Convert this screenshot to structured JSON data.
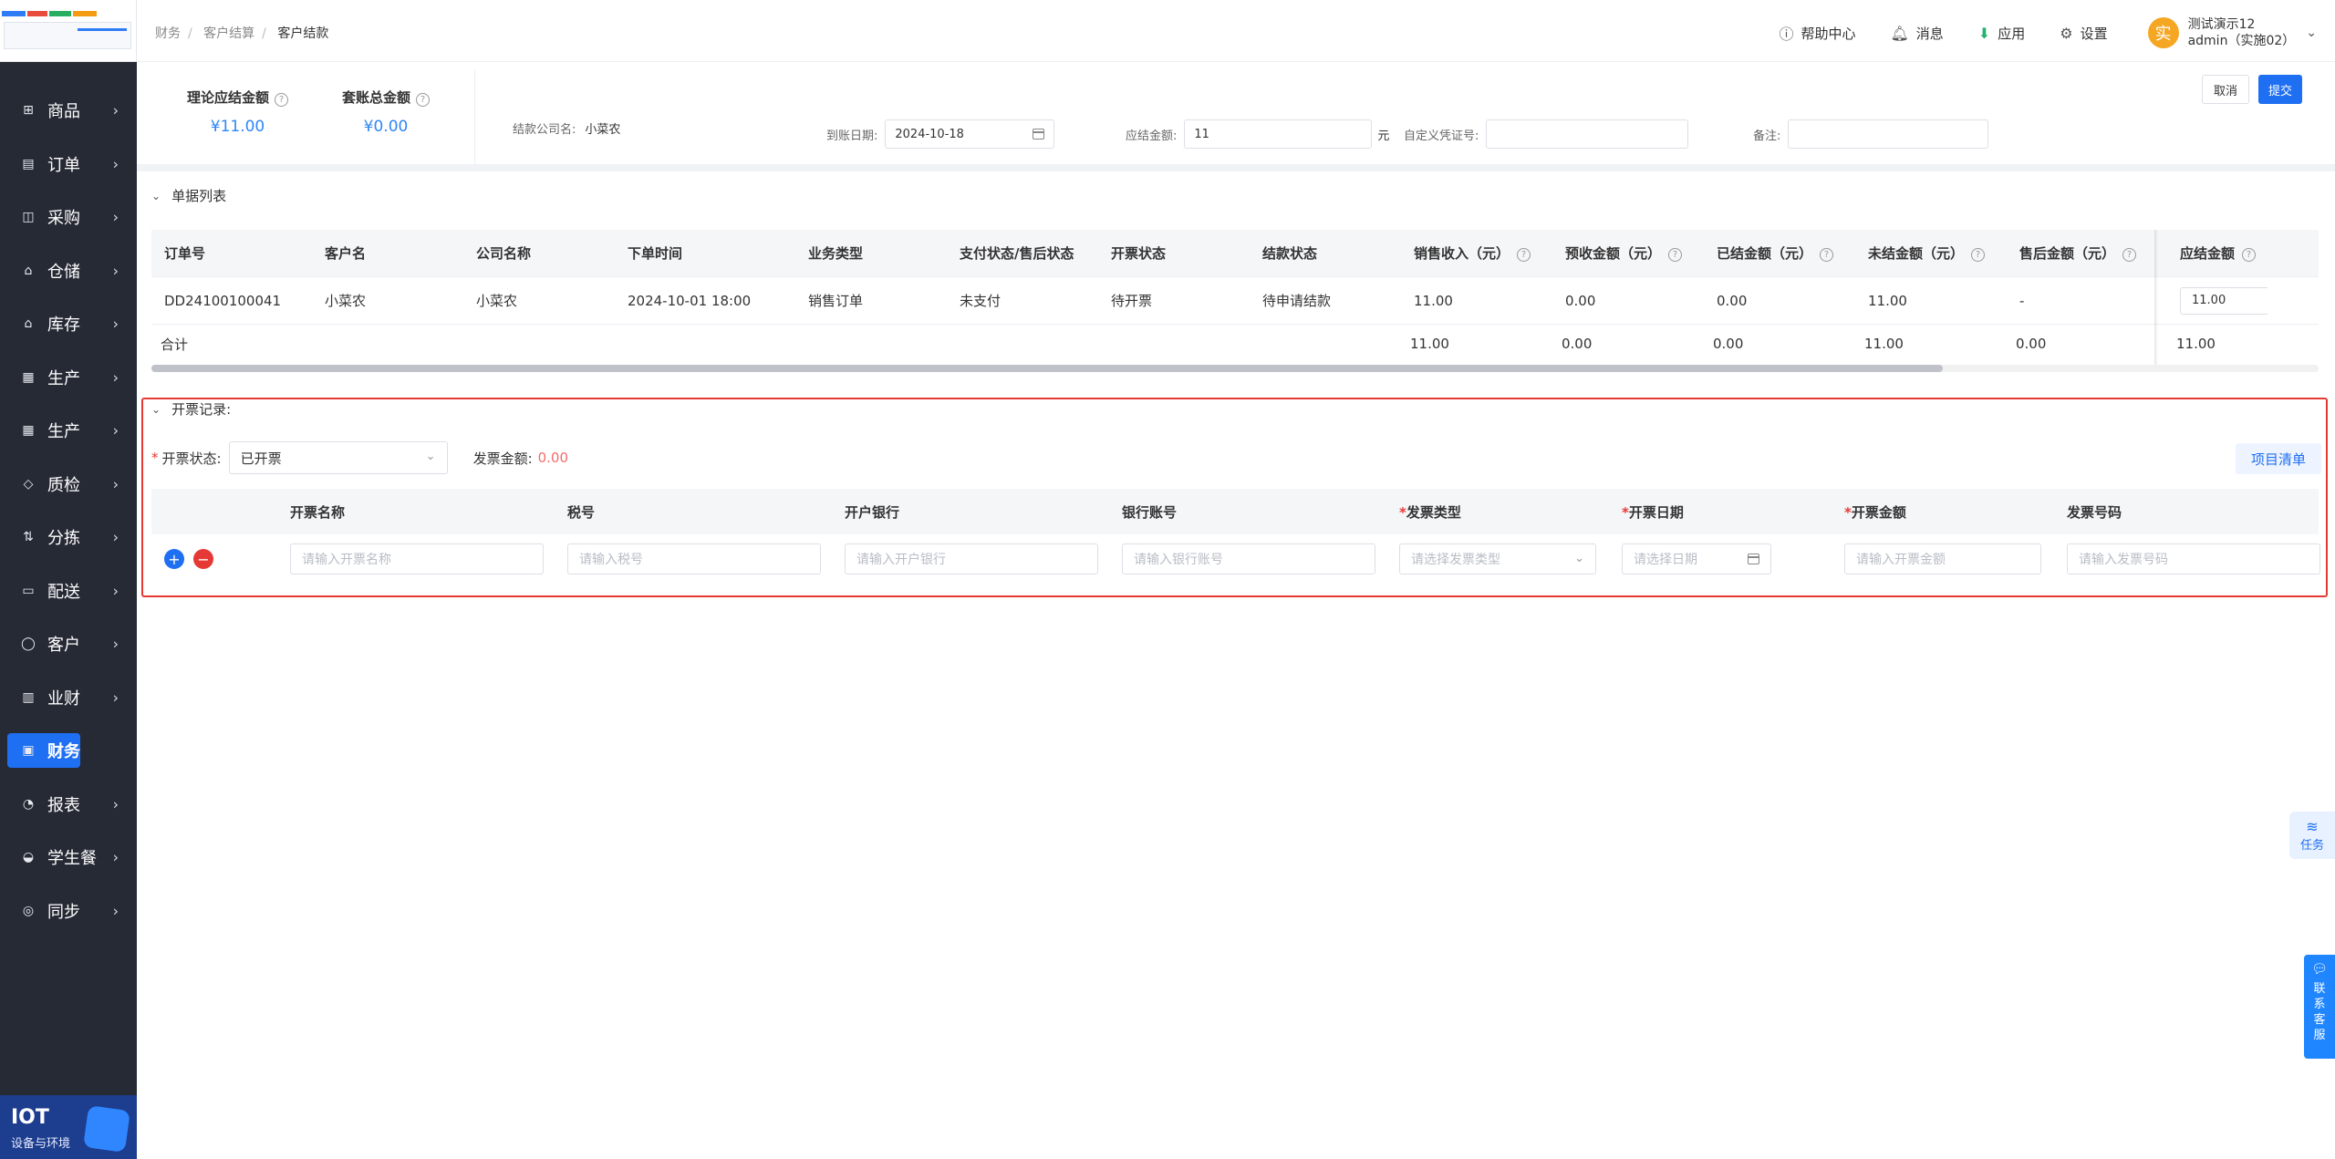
{
  "sidebar": {
    "items": [
      {
        "label": "商品",
        "icon": "grid-icon"
      },
      {
        "label": "订单",
        "icon": "clipboard-icon"
      },
      {
        "label": "采购",
        "icon": "basket-icon"
      },
      {
        "label": "仓储",
        "icon": "warehouse-icon"
      },
      {
        "label": "库存",
        "icon": "home-icon"
      },
      {
        "label": "生产",
        "icon": "factory-icon"
      },
      {
        "label": "生产",
        "icon": "factory-icon"
      },
      {
        "label": "质检",
        "icon": "shield-icon"
      },
      {
        "label": "分拣",
        "icon": "sort-icon"
      },
      {
        "label": "配送",
        "icon": "truck-icon"
      },
      {
        "label": "客户",
        "icon": "user-icon"
      },
      {
        "label": "业财",
        "icon": "chart-icon"
      },
      {
        "label": "财务",
        "icon": "wallet-icon",
        "active": true
      },
      {
        "label": "报表",
        "icon": "clock-icon"
      },
      {
        "label": "学生餐",
        "icon": "dish-icon"
      },
      {
        "label": "同步",
        "icon": "sync-icon"
      }
    ],
    "iot": {
      "title": "IOT",
      "subtitle": "设备与环境"
    }
  },
  "breadcrumb": [
    "财务",
    "客户结算",
    "客户结款"
  ],
  "topbar": {
    "help": "帮助中心",
    "messages": "消息",
    "apps": "应用",
    "settings": "设置",
    "avatar_char": "实",
    "user_line1": "测试演示12",
    "user_line2": "admin（实施02）"
  },
  "summary": {
    "theory_label": "理论应结金额",
    "theory_value": "¥11.00",
    "package_label": "套账总金额",
    "package_value": "¥0.00"
  },
  "form": {
    "company_label": "结款公司名:",
    "company_value": "小菜农",
    "date_label": "到账日期:",
    "date_value": "2024-10-18",
    "amount_label": "应结金额:",
    "amount_value": "11",
    "amount_unit": "元",
    "voucher_label": "自定义凭证号:",
    "voucher_value": "",
    "remark_label": "备注:",
    "remark_value": "",
    "cancel": "取消",
    "submit": "提交"
  },
  "bills": {
    "section_title": "单据列表",
    "columns": [
      "订单号",
      "客户名",
      "公司名称",
      "下单时间",
      "业务类型",
      "支付状态/售后状态",
      "开票状态",
      "结款状态",
      "销售收入（元）",
      "预收金额（元）",
      "已结金额（元）",
      "未结金额（元）",
      "售后金额（元）",
      "应结金额"
    ],
    "rows": [
      [
        "DD24100100041",
        "小菜农",
        "小菜农",
        "2024-10-01 18:00",
        "销售订单",
        "未支付",
        "待开票",
        "待申请结款",
        "11.00",
        "0.00",
        "0.00",
        "11.00",
        "-",
        "11.00"
      ]
    ],
    "total_label": "合计",
    "totals": [
      "11.00",
      "0.00",
      "0.00",
      "11.00",
      "0.00",
      "11.00"
    ]
  },
  "invoice": {
    "section_title": "开票记录:",
    "status_label": "开票状态:",
    "status_value": "已开票",
    "amount_label": "发票金额:",
    "amount_value": "0.00",
    "list_button": "项目清单",
    "columns": [
      "开票名称",
      "税号",
      "开户银行",
      "银行账号",
      "发票类型",
      "开票日期",
      "开票金额",
      "发票号码"
    ],
    "placeholders": [
      "请输入开票名称",
      "请输入税号",
      "请输入开户银行",
      "请输入银行账号",
      "请选择发票类型",
      "请选择日期",
      "请输入开票金额",
      "请输入发票号码"
    ]
  },
  "floating": {
    "task": "任务",
    "service": [
      "联",
      "系",
      "客",
      "服"
    ]
  },
  "colors": {
    "primary": "#1f6ff2",
    "sidebar": "#262a35",
    "danger": "#e53935",
    "amount": "#2f86f6"
  }
}
